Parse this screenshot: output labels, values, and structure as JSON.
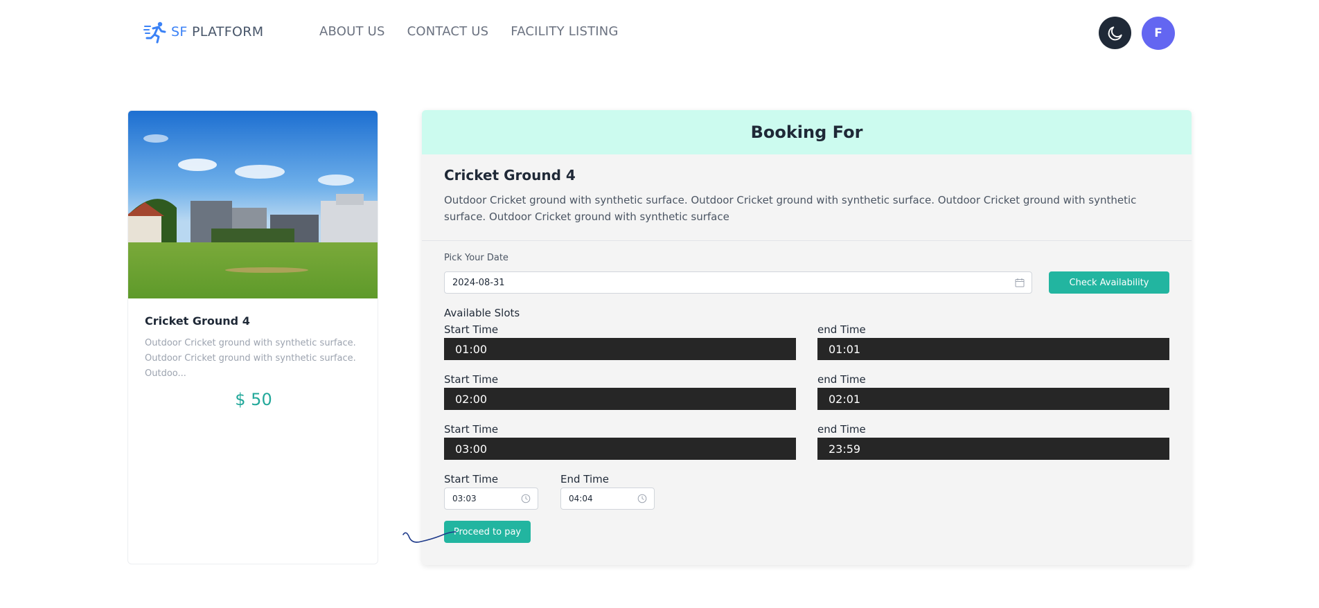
{
  "nav": {
    "brand_sf": "SF",
    "brand_platform": "PLATFORM",
    "links": [
      "ABOUT US",
      "CONTACT US",
      "FACILITY LISTING"
    ],
    "avatar_initial": "F",
    "theme_icon": "moon-icon"
  },
  "card": {
    "title": "Cricket Ground 4",
    "description": "Outdoor Cricket ground with synthetic surface. Outdoor Cricket ground with synthetic surface. Outdoo...",
    "price": "$ 50"
  },
  "booking": {
    "header": "Booking For",
    "facility_title": "Cricket Ground 4",
    "facility_description": "Outdoor Cricket ground with synthetic surface. Outdoor Cricket ground with synthetic surface. Outdoor Cricket ground with synthetic surface. Outdoor Cricket ground with synthetic surface",
    "pick_date_label": "Pick Your Date",
    "date_value": "2024-08-31",
    "check_button": "Check Availability",
    "available_slots_label": "Available Slots",
    "slots": [
      {
        "start_label": "Start Time",
        "start": "01:00",
        "end_label": "end Time",
        "end": "01:01"
      },
      {
        "start_label": "Start Time",
        "start": "02:00",
        "end_label": "end Time",
        "end": "02:01"
      },
      {
        "start_label": "Start Time",
        "start": "03:00",
        "end_label": "end Time",
        "end": "23:59"
      }
    ],
    "start_time_label": "Start Time",
    "start_time_value": "03:03",
    "end_time_label": "End Time",
    "end_time_value": "04:04",
    "pay_button": "Proceed to pay"
  },
  "colors": {
    "accent": "#22b5a0",
    "header_bg": "#ccfbef",
    "avatar_bg": "#6366f1",
    "slot_bg": "#262626"
  }
}
